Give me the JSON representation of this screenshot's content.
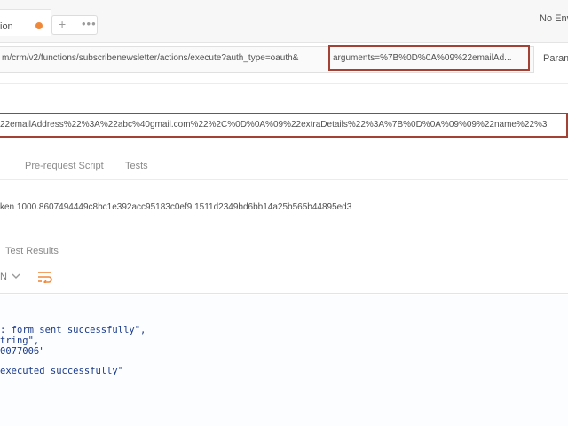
{
  "tabs": {
    "active_label": "ion",
    "add_label": "+",
    "more_label": "•••",
    "unsaved_color": "#f0883a"
  },
  "environment": {
    "label": "No Env"
  },
  "request": {
    "url_text": "m/crm/v2/functions/subscribenewsletter/actions/execute?auth_type=oauth&",
    "url_highlight_text": "arguments=%7B%0D%0A%09%22emailAd...",
    "params_label": "Param",
    "body_text": "22emailAddress%22%3A%22abc%40gmail.com%22%2C%0D%0A%09%22extraDetails%22%3A%7B%0D%0A%09%09%22name%22%3",
    "highlight_color": "#a24134"
  },
  "request_tabs": [
    "Pre-request Script",
    "Tests"
  ],
  "auth": {
    "token_text": "ken 1000.8607494449c8bc1e392acc95183c0ef9.1511d2349bd6bb14a25b565b44895ed3"
  },
  "response": {
    "tab_label": "Test Results",
    "format_label": "N",
    "code_lines": [
      ": form sent successfully\",",
      "tring\",",
      "0077006\"",
      "",
      "executed successfully\""
    ],
    "code_color": "#1a3a8c"
  }
}
